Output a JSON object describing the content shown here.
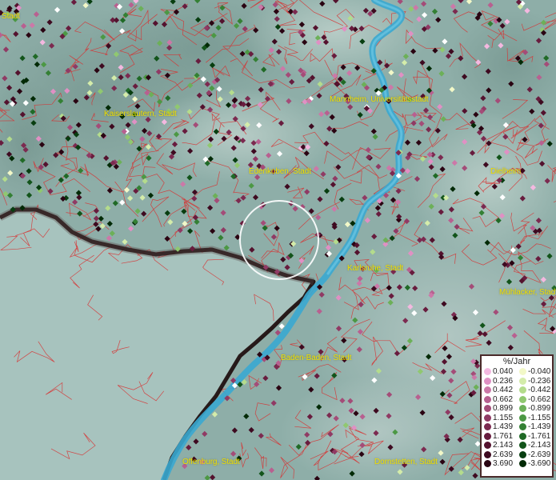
{
  "map": {
    "city_labels": [
      {
        "id": "stadt-partial",
        "text": "Stadt"
      },
      {
        "id": "kaiserslautern",
        "text": "Kaiserslautern, Stadt"
      },
      {
        "id": "mannheim",
        "text": "Mannheim, Universitätsstadt"
      },
      {
        "id": "edenkoben",
        "text": "Edenkoben, Stadt"
      },
      {
        "id": "dielheim",
        "text": "Dielheim"
      },
      {
        "id": "karlsruhe",
        "text": "Karlsruhe, Stadt"
      },
      {
        "id": "muehlacker",
        "text": "Mühlacker, Stadt"
      },
      {
        "id": "baden-baden",
        "text": "Baden-Baden, Stadt"
      },
      {
        "id": "offenburg",
        "text": "Offenburg, Stadt"
      },
      {
        "id": "dornstetten",
        "text": "Dornstetten, Stadt"
      }
    ],
    "colors": {
      "label_text": "#f0e000",
      "admin_boundaries": "#d83030",
      "river": "#3aa8d0",
      "border_line": "#1a0808",
      "selection_circle": "#ffffff"
    }
  },
  "legend": {
    "title": "%/Jahr",
    "positive": [
      {
        "value": "0.040",
        "color": "#f4b8e0"
      },
      {
        "value": "0.236",
        "color": "#e090c4"
      },
      {
        "value": "0.442",
        "color": "#cc78a8"
      },
      {
        "value": "0.662",
        "color": "#b86090"
      },
      {
        "value": "0.899",
        "color": "#a44c78"
      },
      {
        "value": "1.155",
        "color": "#903a64"
      },
      {
        "value": "1.439",
        "color": "#7c2a50"
      },
      {
        "value": "1.761",
        "color": "#681c3e"
      },
      {
        "value": "2.143",
        "color": "#54122e"
      },
      {
        "value": "2.639",
        "color": "#3e0a20"
      },
      {
        "value": "3.690",
        "color": "#2a0412"
      }
    ],
    "negative": [
      {
        "value": "-0.040",
        "color": "#f2f8c8"
      },
      {
        "value": "-0.236",
        "color": "#d4ecaa"
      },
      {
        "value": "-0.442",
        "color": "#b4dc8c"
      },
      {
        "value": "-0.662",
        "color": "#90c870"
      },
      {
        "value": "-0.899",
        "color": "#6cb058"
      },
      {
        "value": "-1.155",
        "color": "#4c9844"
      },
      {
        "value": "-1.439",
        "color": "#348034"
      },
      {
        "value": "-1.761",
        "color": "#206a26"
      },
      {
        "value": "-2.143",
        "color": "#12541a"
      },
      {
        "value": "-2.639",
        "color": "#083e10"
      },
      {
        "value": "-3.690",
        "color": "#022a06"
      }
    ]
  }
}
